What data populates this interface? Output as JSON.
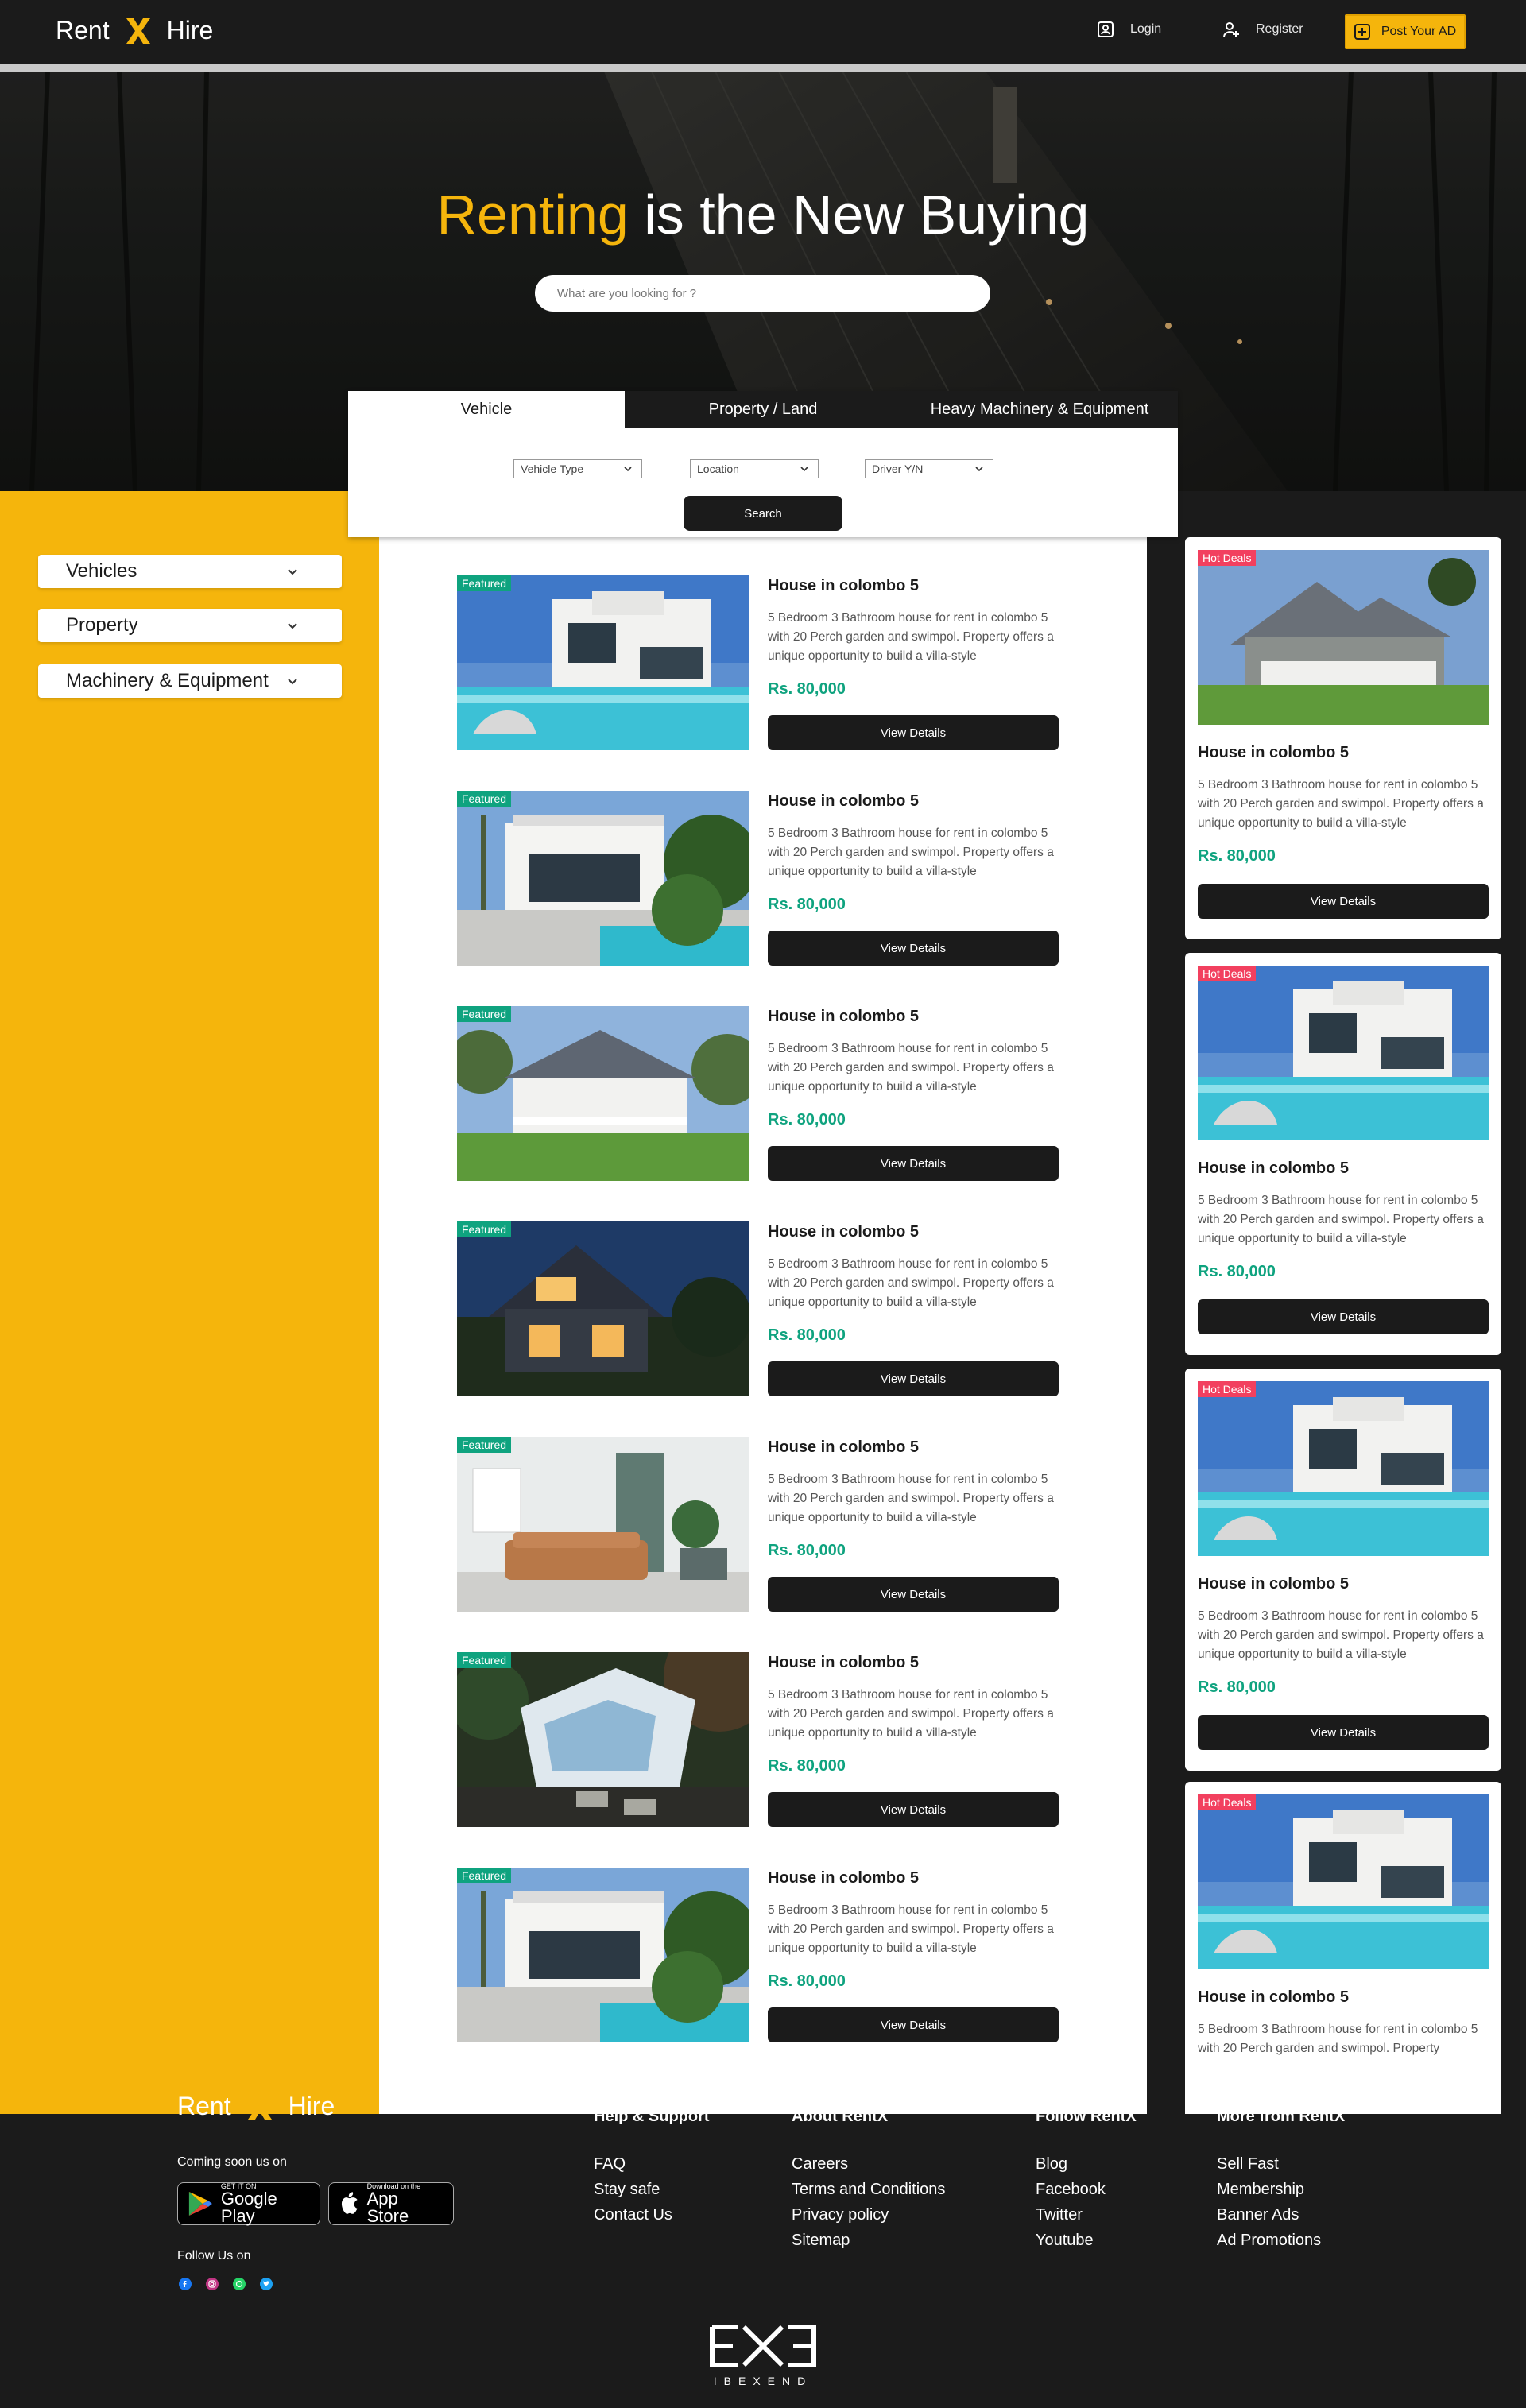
{
  "brand": {
    "left": "Rent",
    "right": "Hire",
    "accent": "#f5b50c"
  },
  "nav": {
    "login": "Login",
    "register": "Register",
    "post_ad": "Post Your AD"
  },
  "hero": {
    "title_accent": "Renting",
    "title_rest": " is the New Buying",
    "search_placeholder": "What are you looking for ?"
  },
  "search_panel": {
    "tabs": [
      "Vehicle",
      "Property / Land",
      "Heavy Machinery & Equipment"
    ],
    "selects": [
      "Vehicle Type",
      "Location",
      "Driver Y/N"
    ],
    "search_label": "Search"
  },
  "sidebar": {
    "items": [
      "Vehicles",
      "Property",
      "Machinery & Equipment"
    ]
  },
  "listings": [
    {
      "badge": "Featured",
      "title": "House in colombo 5",
      "desc": "5 Bedroom 3 Bathroom house for rent in colombo 5 with 20 Perch garden and swimpol. Property offers a unique opportunity to build a villa-style",
      "price": "Rs. 80,000",
      "button": "View Details"
    },
    {
      "badge": "Featured",
      "title": "House in colombo 5",
      "desc": "5 Bedroom 3 Bathroom house for rent in colombo 5 with 20 Perch garden and swimpol. Property offers a unique opportunity to build a villa-style",
      "price": "Rs. 80,000",
      "button": "View Details"
    },
    {
      "badge": "Featured",
      "title": "House in colombo 5",
      "desc": "5 Bedroom 3 Bathroom house for rent in colombo 5 with 20 Perch garden and swimpol. Property offers a unique opportunity to build a villa-style",
      "price": "Rs. 80,000",
      "button": "View Details"
    },
    {
      "badge": "Featured",
      "title": "House in colombo 5",
      "desc": "5 Bedroom 3 Bathroom house for rent in colombo 5 with 20 Perch garden and swimpol. Property offers a unique opportunity to build a villa-style",
      "price": "Rs. 80,000",
      "button": "View Details"
    },
    {
      "badge": "Featured",
      "title": "House in colombo 5",
      "desc": "5 Bedroom 3 Bathroom house for rent in colombo 5 with 20 Perch garden and swimpol. Property offers a unique opportunity to build a villa-style",
      "price": "Rs. 80,000",
      "button": "View Details"
    },
    {
      "badge": "Featured",
      "title": "House in colombo 5",
      "desc": "5 Bedroom 3 Bathroom house for rent in colombo 5 with 20 Perch garden and swimpol. Property offers a unique opportunity to build a villa-style",
      "price": "Rs. 80,000",
      "button": "View Details"
    },
    {
      "badge": "Featured",
      "title": "House in colombo 5",
      "desc": "5 Bedroom 3 Bathroom house for rent in colombo 5 with 20 Perch garden and swimpol. Property offers a unique opportunity to build a villa-style",
      "price": "Rs. 80,000",
      "button": "View Details"
    }
  ],
  "hot_deals": [
    {
      "badge": "Hot Deals",
      "title": "House in colombo 5",
      "desc": "5 Bedroom 3 Bathroom house for rent in colombo 5 with 20 Perch garden and swimpol. Property offers a unique opportunity to build a villa-style",
      "price": "Rs. 80,000",
      "button": "View Details"
    },
    {
      "badge": "Hot Deals",
      "title": "House in colombo 5",
      "desc": "5 Bedroom 3 Bathroom house for rent in colombo 5 with 20 Perch garden and swimpol. Property offers a unique opportunity to build a villa-style",
      "price": "Rs. 80,000",
      "button": "View Details"
    },
    {
      "badge": "Hot Deals",
      "title": "House in colombo 5",
      "desc": "5 Bedroom 3 Bathroom house for rent in colombo 5 with 20 Perch garden and swimpol. Property offers a unique opportunity to build a villa-style",
      "price": "Rs. 80,000",
      "button": "View Details"
    },
    {
      "badge": "Hot Deals",
      "title": "House in colombo 5",
      "desc": "5 Bedroom 3 Bathroom house for rent in colombo 5 with 20 Perch garden and swimpol. Property",
      "price": "",
      "button": ""
    }
  ],
  "footer": {
    "coming_soon": "Coming soon us on",
    "google_small": "GET IT ON",
    "google_big": "Google Play",
    "apple_small": "Download on the",
    "apple_big": "App Store",
    "follow_us": "Follow Us on",
    "columns": [
      {
        "title": "Help & Support",
        "links": [
          "FAQ",
          "Stay safe",
          "Contact Us"
        ]
      },
      {
        "title": "About RentX",
        "links": [
          "Careers",
          "Terms and Conditions",
          "Privacy policy",
          "Sitemap"
        ]
      },
      {
        "title": "Follow RentX",
        "links": [
          "Blog",
          "Facebook",
          "Twitter",
          "Youtube"
        ]
      },
      {
        "title": "More from RentX",
        "links": [
          "Sell Fast",
          "Membership",
          "Banner Ads",
          "Ad Promotions"
        ]
      }
    ],
    "company": "IBEXEND"
  },
  "colors": {
    "accent": "#f5b50c",
    "dark": "#1b1b1b",
    "price": "#0fa37f",
    "featured": "#0fa37f",
    "hot": "#f2405f"
  }
}
